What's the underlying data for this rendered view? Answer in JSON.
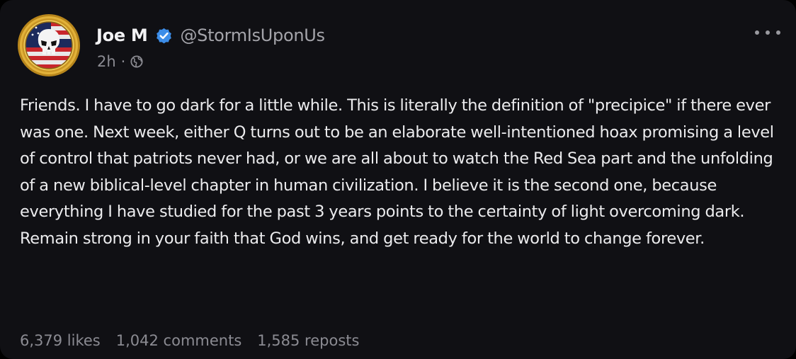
{
  "post": {
    "author": {
      "name": "Joe M",
      "handle": "@StormIsUponUs",
      "verified": true,
      "avatar_icon": "skull-flag-emblem"
    },
    "time": "2h",
    "visibility_icon": "globe-icon",
    "body": "Friends. I have to go dark for a little while. This is literally the definition of \"precipice\" if there ever was one. Next week, either Q turns out to be an elaborate well-intentioned hoax promising a level of control that patriots never had, or we are all about to watch the Red Sea part and the unfolding of a new biblical-level chapter in human civilization. I believe it is the second one, because everything I have studied for the past 3 years points to the certainty of light overcoming dark. Remain strong in your faith that God wins, and get ready for the world to change forever.",
    "stats": {
      "likes": "6,379 likes",
      "comments": "1,042 comments",
      "reposts": "1,585 reposts"
    }
  },
  "colors": {
    "background": "#101014",
    "verified_badge": "#3c8de8",
    "muted_text": "#8b8b92",
    "avatar_ring": "#d9a62a"
  }
}
